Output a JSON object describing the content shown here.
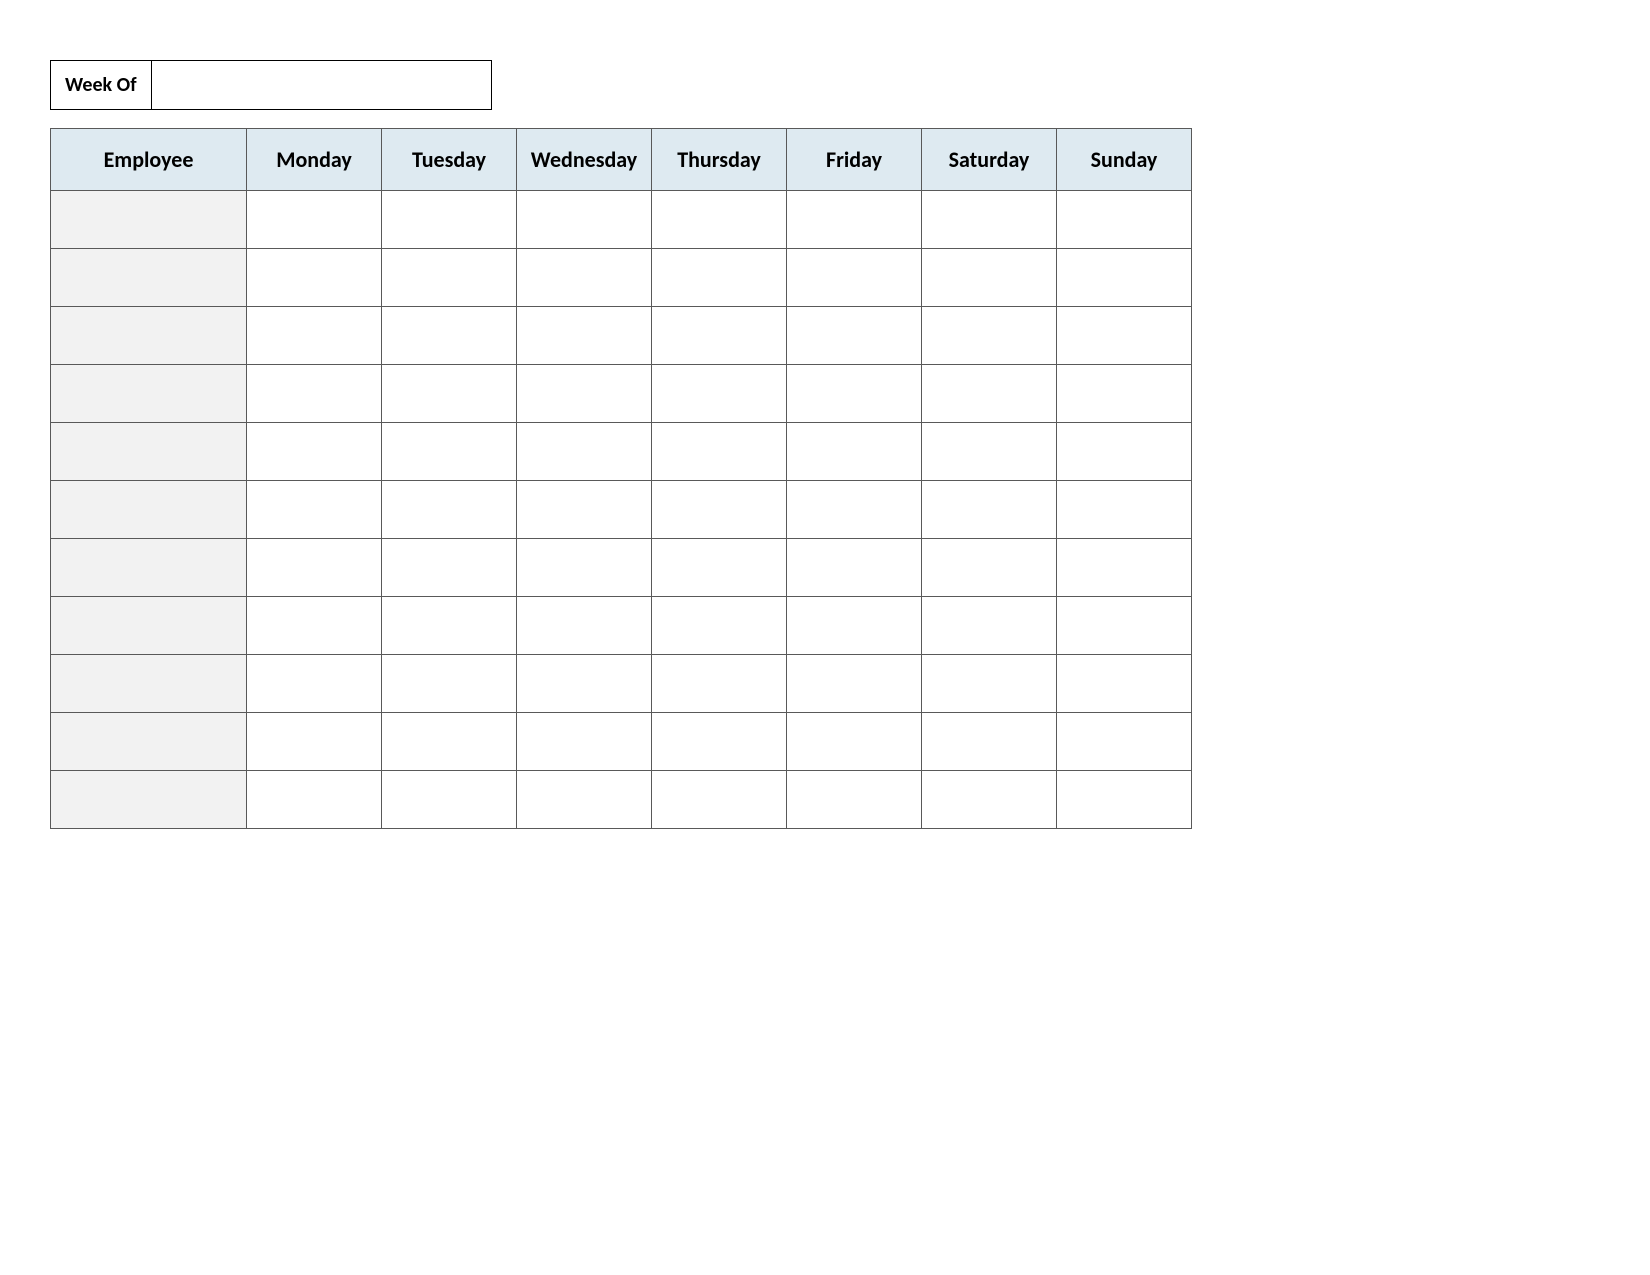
{
  "week_of_label": "Week Of",
  "week_of_value": "",
  "headers": {
    "employee": "Employee",
    "days": [
      "Monday",
      "Tuesday",
      "Wednesday",
      "Thursday",
      "Friday",
      "Saturday",
      "Sunday"
    ]
  },
  "rows": [
    {
      "employee": "",
      "cells": [
        "",
        "",
        "",
        "",
        "",
        "",
        ""
      ]
    },
    {
      "employee": "",
      "cells": [
        "",
        "",
        "",
        "",
        "",
        "",
        ""
      ]
    },
    {
      "employee": "",
      "cells": [
        "",
        "",
        "",
        "",
        "",
        "",
        ""
      ]
    },
    {
      "employee": "",
      "cells": [
        "",
        "",
        "",
        "",
        "",
        "",
        ""
      ]
    },
    {
      "employee": "",
      "cells": [
        "",
        "",
        "",
        "",
        "",
        "",
        ""
      ]
    },
    {
      "employee": "",
      "cells": [
        "",
        "",
        "",
        "",
        "",
        "",
        ""
      ]
    },
    {
      "employee": "",
      "cells": [
        "",
        "",
        "",
        "",
        "",
        "",
        ""
      ]
    },
    {
      "employee": "",
      "cells": [
        "",
        "",
        "",
        "",
        "",
        "",
        ""
      ]
    },
    {
      "employee": "",
      "cells": [
        "",
        "",
        "",
        "",
        "",
        "",
        ""
      ]
    },
    {
      "employee": "",
      "cells": [
        "",
        "",
        "",
        "",
        "",
        "",
        ""
      ]
    },
    {
      "employee": "",
      "cells": [
        "",
        "",
        "",
        "",
        "",
        "",
        ""
      ]
    }
  ]
}
